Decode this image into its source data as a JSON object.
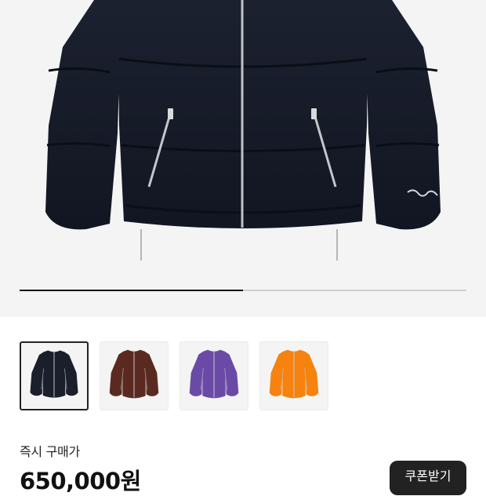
{
  "product": {
    "hero_icon": "black-puffer-jacket-image",
    "gallery_progress": 0.5,
    "thumbnails": [
      {
        "icon": "black-puffer-jacket-thumb",
        "color": "#1a1f2b",
        "selected": true
      },
      {
        "icon": "brown-puffer-jacket-thumb",
        "color": "#5a2a20",
        "selected": false
      },
      {
        "icon": "purple-puffer-jacket-thumb",
        "color": "#6a4aa6",
        "selected": false
      },
      {
        "icon": "orange-puffer-jacket-thumb",
        "color": "#f6820f",
        "selected": false
      }
    ]
  },
  "price": {
    "label": "즉시 구매가",
    "value": "650,000원"
  },
  "coupon": {
    "label": "쿠폰받기"
  }
}
